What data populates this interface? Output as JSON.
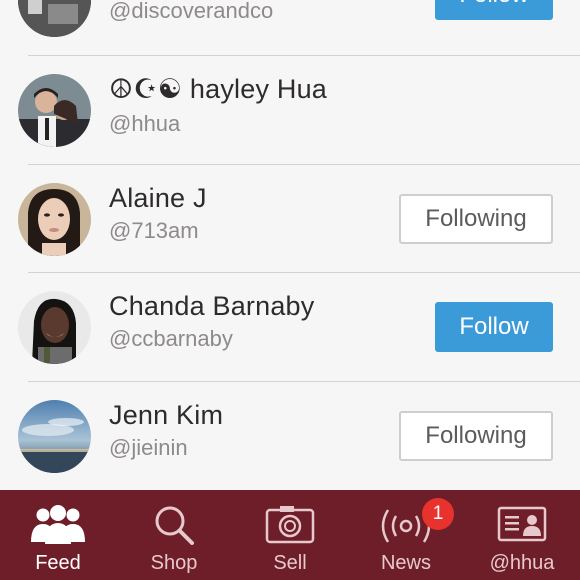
{
  "users": [
    {
      "name": "",
      "handle": "@discoverandco",
      "button": "Follow",
      "state": "follow"
    },
    {
      "name": "☮☪☯ hayley Hua",
      "handle": "@hhua",
      "button": "",
      "state": "none"
    },
    {
      "name": "Alaine J",
      "handle": "@713am",
      "button": "Following",
      "state": "following"
    },
    {
      "name": "Chanda Barnaby",
      "handle": "@ccbarnaby",
      "button": "Follow",
      "state": "follow"
    },
    {
      "name": "Jenn Kim",
      "handle": "@jieinin",
      "button": "Following",
      "state": "following"
    }
  ],
  "tabs": [
    {
      "label": "Feed",
      "icon": "people-icon",
      "active": true
    },
    {
      "label": "Shop",
      "icon": "search-icon",
      "active": false
    },
    {
      "label": "Sell",
      "icon": "camera-icon",
      "active": false
    },
    {
      "label": "News",
      "icon": "broadcast-icon",
      "active": false,
      "badge": "1"
    },
    {
      "label": "@hhua",
      "icon": "profile-card-icon",
      "active": false
    }
  ],
  "colors": {
    "tabbar": "#6e1e28",
    "follow": "#3b9bd9",
    "badge": "#e8322d"
  }
}
